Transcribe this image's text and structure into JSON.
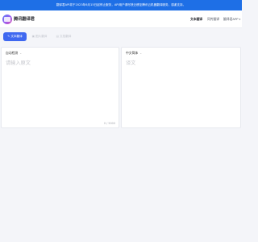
{
  "notice": "翻译君API将于2023年6月15日起停止服务，API用户请尽快迁移至腾讯云机器翻译服务，感谢支持。",
  "header": {
    "brand": "腾讯翻译君",
    "nav": [
      {
        "label": "文本翻译",
        "active": true
      },
      {
        "label": "同传翻译",
        "active": false
      },
      {
        "label": "翻译君APP",
        "active": false,
        "caret": "▾"
      }
    ]
  },
  "tabs": [
    {
      "label": "文本翻译",
      "icon": "✎",
      "active": true
    },
    {
      "label": "图片翻译",
      "icon": "▣",
      "active": false
    },
    {
      "label": "文档翻译",
      "icon": "▤",
      "active": false
    }
  ],
  "source_panel": {
    "language": "自动检测",
    "caret": "⌄",
    "placeholder": "请输入原文",
    "counter": "0 / 5000"
  },
  "target_panel": {
    "language": "中文简体",
    "caret": "⌄",
    "placeholder": "译文"
  },
  "colors": {
    "notice_bg": "#1e6fe6",
    "accent": "#3f68f0",
    "page_bg": "#f4f5f9"
  }
}
